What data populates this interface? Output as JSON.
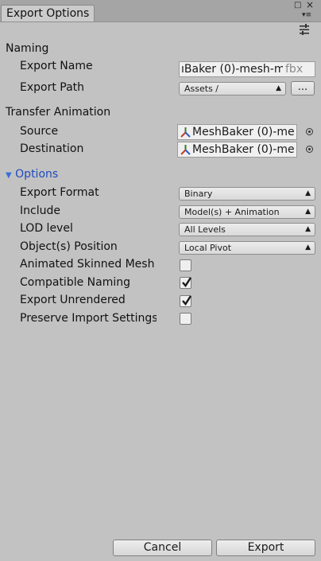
{
  "window": {
    "tab_title": "Export Options"
  },
  "naming": {
    "section_label": "Naming",
    "export_name_label": "Export Name",
    "export_name_value": "ıBaker (0)-mesh-m",
    "export_name_suffix": "fbx",
    "export_path_label": "Export Path",
    "export_path_value": "Assets /",
    "browse_label": "..."
  },
  "transfer": {
    "section_label": "Transfer Animation",
    "source_label": "Source",
    "source_value": "MeshBaker (0)-me",
    "destination_label": "Destination",
    "destination_value": "MeshBaker (0)-me"
  },
  "options": {
    "foldout_label": "Options",
    "export_format_label": "Export Format",
    "export_format_value": "Binary",
    "include_label": "Include",
    "include_value": "Model(s) + Animation",
    "lod_label": "LOD level",
    "lod_value": "All Levels",
    "position_label": "Object(s) Position",
    "position_value": "Local Pivot",
    "checkboxes": [
      {
        "label": "Animated Skinned Mesh",
        "checked": false
      },
      {
        "label": "Compatible Naming",
        "checked": true
      },
      {
        "label": "Export Unrendered",
        "checked": true
      },
      {
        "label": "Preserve Import Settings",
        "checked": false
      }
    ]
  },
  "footer": {
    "cancel_label": "Cancel",
    "export_label": "Export"
  }
}
